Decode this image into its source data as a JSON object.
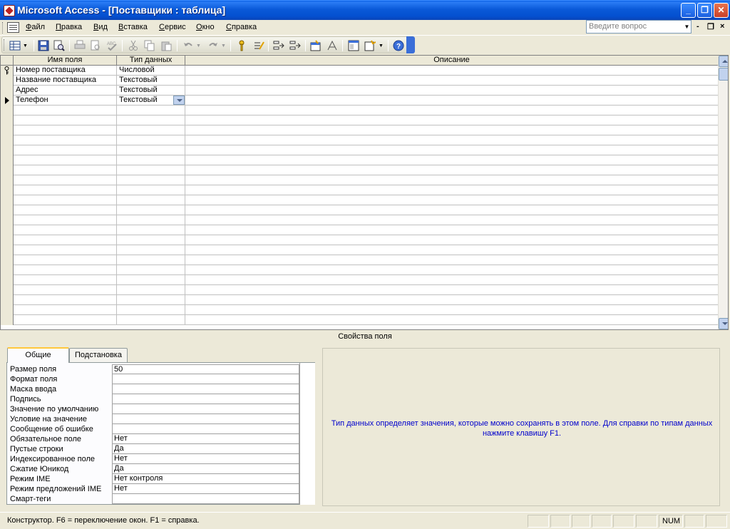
{
  "window": {
    "title": "Microsoft Access - [Поставщики : таблица]",
    "min": "_",
    "max": "❐",
    "close": "✕"
  },
  "menu": {
    "items": [
      {
        "label": "Файл"
      },
      {
        "label": "Правка"
      },
      {
        "label": "Вид"
      },
      {
        "label": "Вставка"
      },
      {
        "label": "Сервис"
      },
      {
        "label": "Окно"
      },
      {
        "label": "Справка"
      }
    ],
    "help_placeholder": "Введите вопрос",
    "mdi_min": "-",
    "mdi_restore": "❐",
    "mdi_close": "×"
  },
  "toolbar": {
    "icons": [
      "view-icon",
      "save-icon",
      "search-icon",
      "print-icon",
      "print-preview-icon",
      "spelling-icon",
      "cut-icon",
      "copy-icon",
      "paste-icon",
      "undo-icon",
      "redo-icon",
      "primary-key-icon",
      "indexes-icon",
      "insert-rows-icon",
      "delete-rows-icon",
      "properties-icon",
      "build-icon",
      "database-window-icon",
      "new-object-icon",
      "help-icon"
    ]
  },
  "grid": {
    "headers": {
      "name": "Имя поля",
      "type": "Тип данных",
      "description": "Описание"
    },
    "rows": [
      {
        "name": "Номер поставщика",
        "type": "Числовой",
        "description": "",
        "primary_key": true
      },
      {
        "name": "Название поставщика",
        "type": "Текстовый",
        "description": ""
      },
      {
        "name": "Адрес",
        "type": "Текстовый",
        "description": ""
      },
      {
        "name": "Телефон",
        "type": "Текстовый",
        "description": "",
        "current": true
      }
    ]
  },
  "properties": {
    "title": "Свойства поля",
    "tabs": [
      {
        "label": "Общие",
        "active": true
      },
      {
        "label": "Подстановка"
      }
    ],
    "rows": [
      {
        "label": "Размер поля",
        "value": "50"
      },
      {
        "label": "Формат поля",
        "value": ""
      },
      {
        "label": "Маска ввода",
        "value": ""
      },
      {
        "label": "Подпись",
        "value": ""
      },
      {
        "label": "Значение по умолчанию",
        "value": ""
      },
      {
        "label": "Условие на значение",
        "value": ""
      },
      {
        "label": "Сообщение об ошибке",
        "value": ""
      },
      {
        "label": "Обязательное поле",
        "value": "Нет"
      },
      {
        "label": "Пустые строки",
        "value": "Да"
      },
      {
        "label": "Индексированное поле",
        "value": "Нет"
      },
      {
        "label": "Сжатие Юникод",
        "value": "Да"
      },
      {
        "label": "Режим IME",
        "value": "Нет контроля"
      },
      {
        "label": "Режим предложений IME",
        "value": "Нет"
      },
      {
        "label": "Смарт-теги",
        "value": ""
      }
    ],
    "hint": "Тип данных определяет значения, которые можно сохранять в этом поле.  Для справки по типам данных нажмите клавишу F1."
  },
  "status": {
    "text": "Конструктор.  F6 = переключение окон.  F1 = справка.",
    "num": "NUM"
  }
}
